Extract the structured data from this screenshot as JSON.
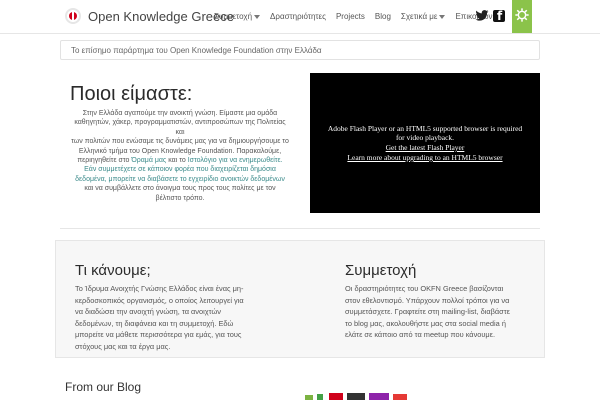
{
  "header": {
    "brand": "Open Knowledge Greece",
    "nav": [
      {
        "label": "Συμμετοχή",
        "has_dropdown": true
      },
      {
        "label": "Δραστηριότητες",
        "has_dropdown": false
      },
      {
        "label": "Projects",
        "has_dropdown": false
      },
      {
        "label": "Blog",
        "has_dropdown": false
      },
      {
        "label": "Σχετικά με",
        "has_dropdown": true
      },
      {
        "label": "Επικοινωνία",
        "has_dropdown": false
      }
    ],
    "icons": [
      "logo-icon",
      "twitter-icon",
      "facebook-icon",
      "gear-icon"
    ],
    "accent_color": "#8bc34a"
  },
  "tagline": "Το επίσημο παράρτημα του Open Knowledge Foundation στην Ελλάδα",
  "who": {
    "title": "Ποιοι είμαστε:",
    "text_lines": [
      "Στην Ελλάδα αγαπούμε την ανοικτή γνώση. Είμαστε μια ομάδα",
      "καθηγητών, χάκερ, προγραμματιστών, αντιπροσώπων της Πολιτείας και",
      "των πολιτών που ενώσαμε τις δυνάμεις μας για να δημιουργήσουμε το",
      "Ελληνικό τμήμα του Open Knowledge Foundation. Παρακαλούμε,",
      "περιηγηθείτε στο ",
      "Εάν συμμετέχετε σε κάποιον φορέα που διαχειρίζεται δημόσια",
      "δεδομένα, μπορείτε να διαβάσετε το εγχειρίδιο ανοικτών δεδομένων",
      "και να συμβάλλετε στο άνοιγμα τους προς τους πολίτες με τον",
      "βέλτιστο τρόπο."
    ],
    "link_vision": "Όραμά μας",
    "and_text": " και το ",
    "link_blog": "Ιστολόγιο για να ενημερωθείτε."
  },
  "video": {
    "line1": "Adobe Flash Player or an HTML5 supported browser is required",
    "line2": "for video playback.",
    "line3": "Get the latest Flash Player",
    "line4": "Learn more about upgrading to an HTML5 browser"
  },
  "what": {
    "title": "Τι κάνουμε;",
    "lines": [
      "Το Ίδρυμα Ανοιχτής Γνώσης Ελλάδος είναι ένας μη-",
      "κερδοσκοπικός οργανισμός, ο οποίος λειτουργεί για",
      "να διαδώσει την ανοιχτή γνώση, τα ανοιχτών",
      "δεδομένων, τη διαφάνεια και τη συμμετοχή. Εδώ",
      "μπορείτε να μάθετε περισσότερα για εμάς, για τους",
      "στόχους μας και τα έργα μας."
    ]
  },
  "participation": {
    "title": "Συμμετοχή",
    "lines": [
      "Οι δραστηριότητες του OKFN Greece βασίζονται",
      "στον εθελοντισμό. Υπάρχουν πολλοί τρόποι για να",
      "συμμετάσχετε. Γραφτείτε στη mailing-list, διαβάστε",
      "το blog μας, ακολουθήστε μας στα social media ή",
      "ελάτε σε κάποιο από τα meetup που κάνουμε."
    ]
  },
  "blog": {
    "title": "From our Blog"
  }
}
